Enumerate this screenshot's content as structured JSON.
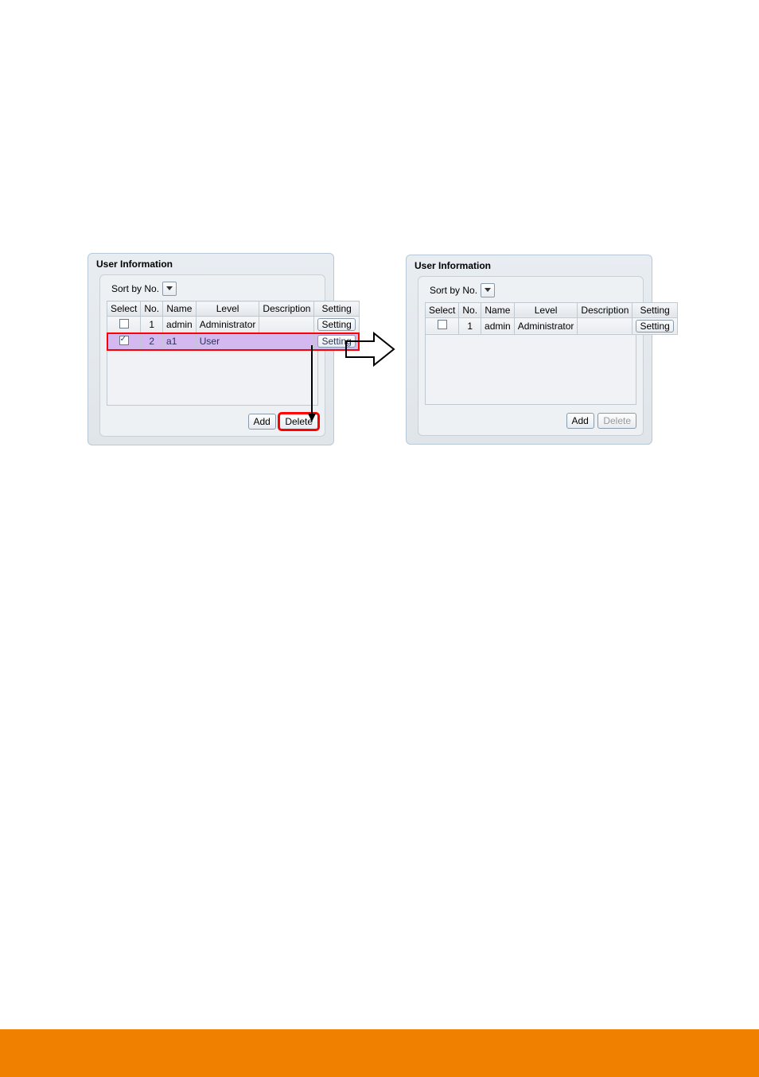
{
  "panel_title": "User Information",
  "sort_label": "Sort by No.",
  "columns": {
    "select": "Select",
    "no": "No.",
    "name": "Name",
    "level": "Level",
    "description": "Description",
    "setting": "Setting"
  },
  "left_panel": {
    "rows": [
      {
        "checked": false,
        "no": "1",
        "name": "admin",
        "level": "Administrator",
        "description": "",
        "setting": "Setting"
      },
      {
        "checked": true,
        "no": "2",
        "name": "a1",
        "level": "User",
        "description": "",
        "setting": "Setting"
      }
    ]
  },
  "right_panel": {
    "rows": [
      {
        "checked": false,
        "no": "1",
        "name": "admin",
        "level": "Administrator",
        "description": "",
        "setting": "Setting"
      }
    ]
  },
  "buttons": {
    "add": "Add",
    "delete": "Delete"
  }
}
